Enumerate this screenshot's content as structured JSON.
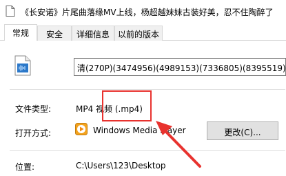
{
  "window": {
    "title": "《长安诺》片尾曲落缘MV上线，杨超越妹妹古装好美，忍不住陶醉了",
    "title_icon": "document-icon"
  },
  "tabs": [
    {
      "label": "常规",
      "active": true
    },
    {
      "label": "安全",
      "active": false
    },
    {
      "label": "详细信息",
      "active": false
    },
    {
      "label": "以前的版本",
      "active": false
    }
  ],
  "general": {
    "file_name": "清(270P)(3474956)(4989153)(7336805)(8395519)",
    "file_type_label": "文件类型:",
    "file_type_value": "MP4 视频 (.mp4)",
    "open_with_label": "打开方式:",
    "open_with_app": "Windows Media Player",
    "change_button": "更改(C)...",
    "location_label": "位置:",
    "location_value": "C:\\Users\\123\\Desktop"
  },
  "annotation": {
    "color": "#e8322e"
  }
}
